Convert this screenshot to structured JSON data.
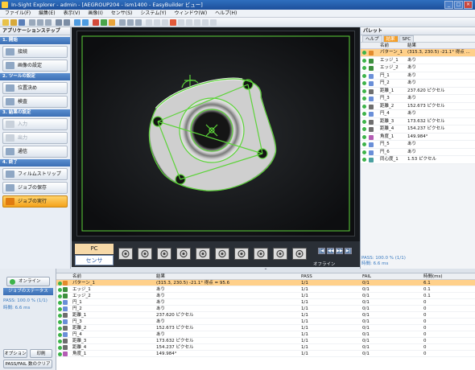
{
  "window": {
    "title": "In-Sight Explorer - admin - [AEGROUP204 - ism1400 - EasyBuilder ビュー]",
    "controls": [
      "_",
      "□",
      "×"
    ]
  },
  "menu": [
    "ファイル(F)",
    "編集(E)",
    "表示(V)",
    "画像(I)",
    "センサ(S)",
    "システム(Y)",
    "ウィンドウ(W)",
    "ヘルプ(H)"
  ],
  "app_steps": {
    "title": "アプリケーションステップ",
    "sections": [
      {
        "label": "1. 開始",
        "items": [
          {
            "label": "接続",
            "enabled": true
          },
          {
            "label": "画像の設定",
            "enabled": true
          }
        ]
      },
      {
        "label": "2. ツールの設定",
        "items": [
          {
            "label": "位置決め",
            "enabled": true
          },
          {
            "label": "検査",
            "enabled": true
          }
        ]
      },
      {
        "label": "3. 結果の設定",
        "items": [
          {
            "label": "入力",
            "enabled": false
          },
          {
            "label": "出力",
            "enabled": false
          },
          {
            "label": "通信",
            "enabled": true
          }
        ]
      },
      {
        "label": "4. 終了",
        "items": [
          {
            "label": "フィルムストリップ",
            "enabled": true
          },
          {
            "label": "ジョブの保存",
            "enabled": true
          },
          {
            "label": "ジョブの実行",
            "enabled": true,
            "active": true
          }
        ]
      }
    ]
  },
  "filmstrip": {
    "pc_label": "PC",
    "sensor_label": "センサ",
    "frame_count": 10,
    "status": "オフライン",
    "nav": [
      "|◀",
      "◀◀",
      "▶▶",
      "▶|"
    ]
  },
  "palette": {
    "title": "パレット",
    "tabs": [
      "ヘルプ",
      "結果",
      "SPC"
    ],
    "selected_tab": 1,
    "columns": [
      "名前",
      "結果"
    ],
    "rows": [
      {
        "name": "パターン_1",
        "result": "(315.3, 230.5) -21.1° 得点 ...",
        "icon": "pattern",
        "hl": true
      },
      {
        "name": "エッジ_1",
        "result": "あり",
        "icon": "edge"
      },
      {
        "name": "エッジ_2",
        "result": "あり",
        "icon": "edge"
      },
      {
        "name": "円_1",
        "result": "あり",
        "icon": "circle"
      },
      {
        "name": "円_2",
        "result": "あり",
        "icon": "circle"
      },
      {
        "name": "距離_1",
        "result": "237.620 ピクセル",
        "icon": "distance"
      },
      {
        "name": "円_3",
        "result": "あり",
        "icon": "circle"
      },
      {
        "name": "距離_2",
        "result": "152.673 ピクセル",
        "icon": "distance"
      },
      {
        "name": "円_4",
        "result": "あり",
        "icon": "circle"
      },
      {
        "name": "距離_3",
        "result": "173.632 ピクセル",
        "icon": "distance"
      },
      {
        "name": "距離_4",
        "result": "154.237 ピクセル",
        "icon": "distance"
      },
      {
        "name": "角度_1",
        "result": "149.984°",
        "icon": "angle"
      },
      {
        "name": "円_5",
        "result": "あり",
        "icon": "circle"
      },
      {
        "name": "円_6",
        "result": "あり",
        "icon": "circle"
      },
      {
        "name": "同心度_1",
        "result": "1.53 ピクセル",
        "icon": "concentric"
      }
    ],
    "status_lines": [
      "PASS: 100.0 % (1/1)",
      "時間: 6.6 ms"
    ]
  },
  "job_status": {
    "online_label": "オンライン",
    "title": "ジョブのステータス",
    "pass": "PASS: 100.0 % (1/1)",
    "time": "時間: 6.6 ms",
    "options_label": "オプション",
    "print_label": "印刷",
    "clear_label": "PASS/FAIL 数のクリア"
  },
  "results_table": {
    "columns": [
      "名前",
      "結果",
      "PASS",
      "FAIL",
      "時間(ms)"
    ],
    "rows": [
      {
        "name": "パターン_1",
        "result": "(315.3, 230.5) -21.1° 得点 = 95.6",
        "pass": "1/1",
        "fail": "0/1",
        "time": "6.1",
        "icon": "pattern",
        "hl": true
      },
      {
        "name": "エッジ_1",
        "result": "あり",
        "pass": "1/1",
        "fail": "0/1",
        "time": "0.1",
        "icon": "edge"
      },
      {
        "name": "エッジ_2",
        "result": "あり",
        "pass": "1/1",
        "fail": "0/1",
        "time": "0.1",
        "icon": "edge"
      },
      {
        "name": "円_1",
        "result": "あり",
        "pass": "1/1",
        "fail": "0/1",
        "time": "0",
        "icon": "circle"
      },
      {
        "name": "円_2",
        "result": "あり",
        "pass": "1/1",
        "fail": "0/1",
        "time": "0",
        "icon": "circle"
      },
      {
        "name": "距離_1",
        "result": "237.620 ピクセル",
        "pass": "1/1",
        "fail": "0/1",
        "time": "0",
        "icon": "distance"
      },
      {
        "name": "円_3",
        "result": "あり",
        "pass": "1/1",
        "fail": "0/1",
        "time": "0",
        "icon": "circle"
      },
      {
        "name": "距離_2",
        "result": "152.673 ピクセル",
        "pass": "1/1",
        "fail": "0/1",
        "time": "0",
        "icon": "distance"
      },
      {
        "name": "円_4",
        "result": "あり",
        "pass": "1/1",
        "fail": "0/1",
        "time": "0",
        "icon": "circle"
      },
      {
        "name": "距離_3",
        "result": "173.632 ピクセル",
        "pass": "1/1",
        "fail": "0/1",
        "time": "0",
        "icon": "distance"
      },
      {
        "name": "距離_4",
        "result": "154.237 ピクセル",
        "pass": "1/1",
        "fail": "0/1",
        "time": "0",
        "icon": "distance"
      },
      {
        "name": "角度_1",
        "result": "149.984°",
        "pass": "1/1",
        "fail": "0/1",
        "time": "0",
        "icon": "angle"
      }
    ]
  },
  "colors": {
    "accent": "#f59e26",
    "pass_green": "#3db34a",
    "overlay_green": "#5dd33a"
  }
}
